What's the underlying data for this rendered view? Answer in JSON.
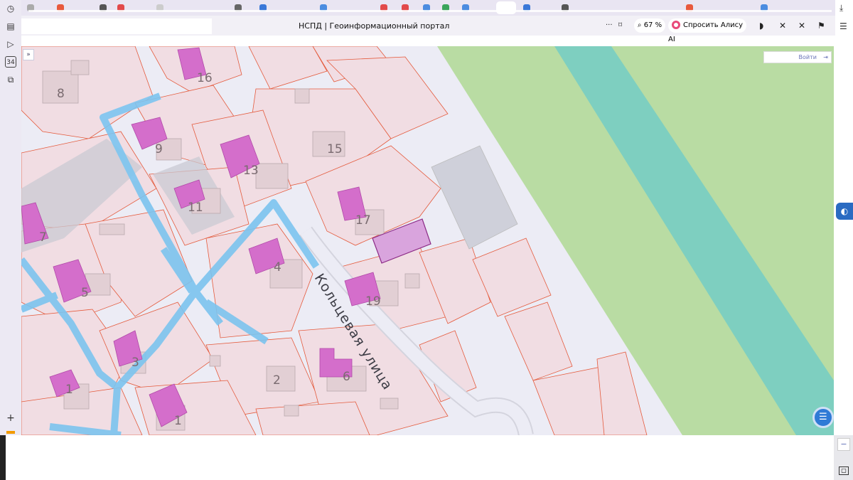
{
  "browser": {
    "page_title": "НСПД | Геоинформационный портал",
    "zoom": "67 %",
    "alice_label": "Спросить Алису AI",
    "more_icon": "ellipsis-icon",
    "bookmark_icon": "bookmark-icon",
    "download_icon": "download-icon"
  },
  "map": {
    "login_label": "Войти",
    "street_label": "Кольцевая улица",
    "plot_numbers": [
      "8",
      "16",
      "9",
      "13",
      "15",
      "11",
      "17",
      "7",
      "4",
      "5",
      "19",
      "3",
      "2",
      "6",
      "1",
      "1"
    ],
    "colors": {
      "parcel": "#f1dde3",
      "building": "#d46ecb",
      "road": "#e9e9f3",
      "green": "#b9dca3",
      "canal": "#7ecfc0",
      "water_line": "#7cc4ef",
      "boundary": "#e45a3c"
    }
  },
  "sidebar": {
    "badge": "34"
  }
}
